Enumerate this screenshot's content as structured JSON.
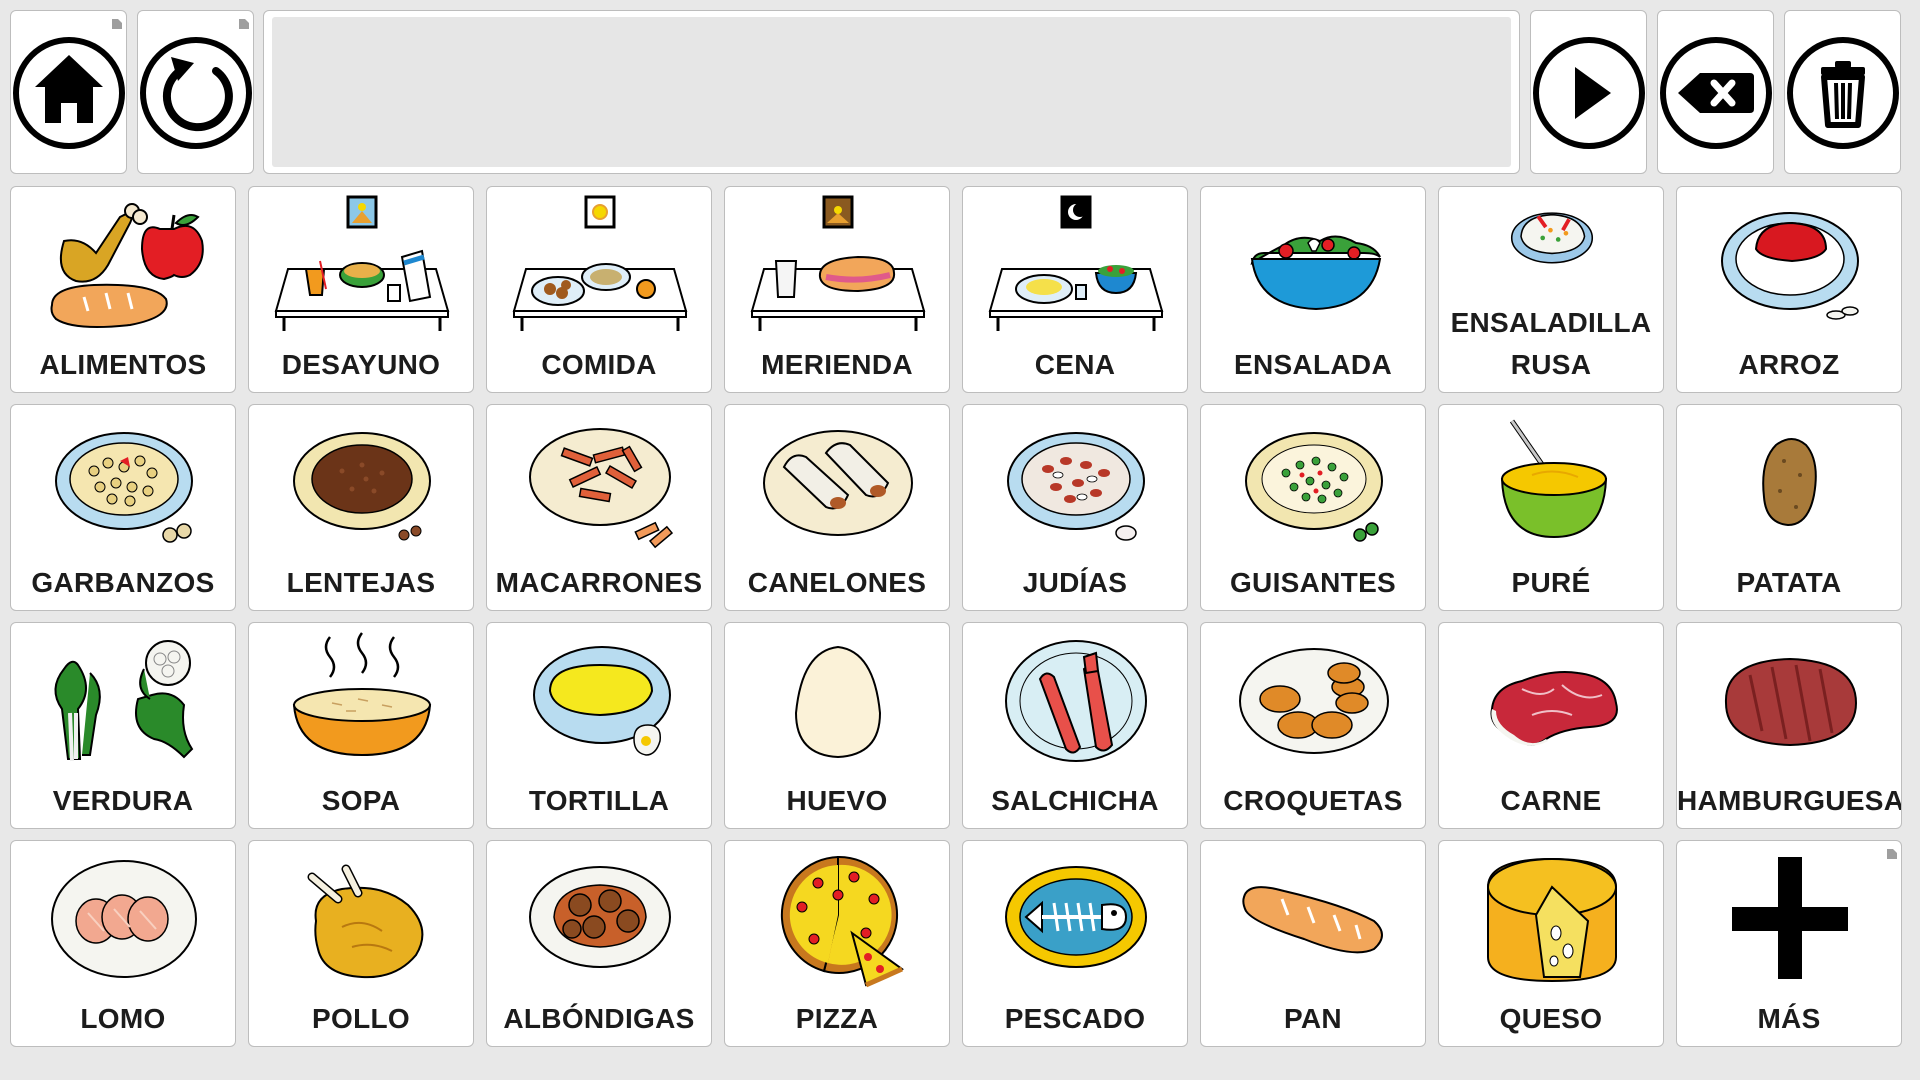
{
  "toolbar": {
    "home_button": {
      "icon": "home-icon"
    },
    "back_button": {
      "icon": "undo-icon"
    },
    "sentence_text": "",
    "speak_button": {
      "icon": "play-icon"
    },
    "backspace_button": {
      "icon": "backspace-icon"
    },
    "clear_button": {
      "icon": "trash-icon"
    }
  },
  "grid": {
    "rows": [
      [
        {
          "label": "ALIMENTOS",
          "icon": "food-group-icon"
        },
        {
          "label": "DESAYUNO",
          "icon": "breakfast-table-icon"
        },
        {
          "label": "COMIDA",
          "icon": "lunch-table-icon"
        },
        {
          "label": "MERIENDA",
          "icon": "snack-table-icon"
        },
        {
          "label": "CENA",
          "icon": "dinner-table-icon"
        },
        {
          "label": "ENSALADA",
          "icon": "salad-bowl-icon"
        },
        {
          "label": "ENSALADILLA RUSA",
          "label_line1": "ENSALADILLA",
          "label_line2": "RUSA",
          "icon": "russian-salad-icon"
        },
        {
          "label": "ARROZ",
          "icon": "rice-plate-icon"
        }
      ],
      [
        {
          "label": "GARBANZOS",
          "icon": "chickpeas-plate-icon"
        },
        {
          "label": "LENTEJAS",
          "icon": "lentils-plate-icon"
        },
        {
          "label": "MACARRONES",
          "icon": "macaroni-plate-icon"
        },
        {
          "label": "CANELONES",
          "icon": "cannelloni-plate-icon"
        },
        {
          "label": "JUDÍAS",
          "icon": "beans-plate-icon"
        },
        {
          "label": "GUISANTES",
          "icon": "peas-plate-icon"
        },
        {
          "label": "PURÉ",
          "icon": "puree-bowl-icon"
        },
        {
          "label": "PATATA",
          "icon": "potato-icon"
        }
      ],
      [
        {
          "label": "VERDURA",
          "icon": "vegetables-icon"
        },
        {
          "label": "SOPA",
          "icon": "soup-bowl-icon"
        },
        {
          "label": "TORTILLA",
          "icon": "omelette-plate-icon"
        },
        {
          "label": "HUEVO",
          "icon": "egg-icon"
        },
        {
          "label": "SALCHICHA",
          "icon": "sausage-plate-icon"
        },
        {
          "label": "CROQUETAS",
          "icon": "croquettes-plate-icon"
        },
        {
          "label": "CARNE",
          "icon": "steak-icon"
        },
        {
          "label": "HAMBURGUESA",
          "icon": "burger-patty-icon"
        }
      ],
      [
        {
          "label": "LOMO",
          "icon": "pork-loin-plate-icon"
        },
        {
          "label": "POLLO",
          "icon": "roast-chicken-icon"
        },
        {
          "label": "ALBÓNDIGAS",
          "icon": "meatballs-plate-icon"
        },
        {
          "label": "PIZZA",
          "icon": "pizza-icon"
        },
        {
          "label": "PESCADO",
          "icon": "fish-plate-icon"
        },
        {
          "label": "PAN",
          "icon": "bread-icon"
        },
        {
          "label": "QUESO",
          "icon": "cheese-icon"
        },
        {
          "label": "MÁS",
          "icon": "plus-icon"
        }
      ]
    ]
  },
  "colors": {
    "background": "#e8e8e8",
    "tile": "#ffffff",
    "tile_border": "#bdbdbd",
    "label": "#1c1c1c",
    "icon_stroke": "#000000"
  }
}
